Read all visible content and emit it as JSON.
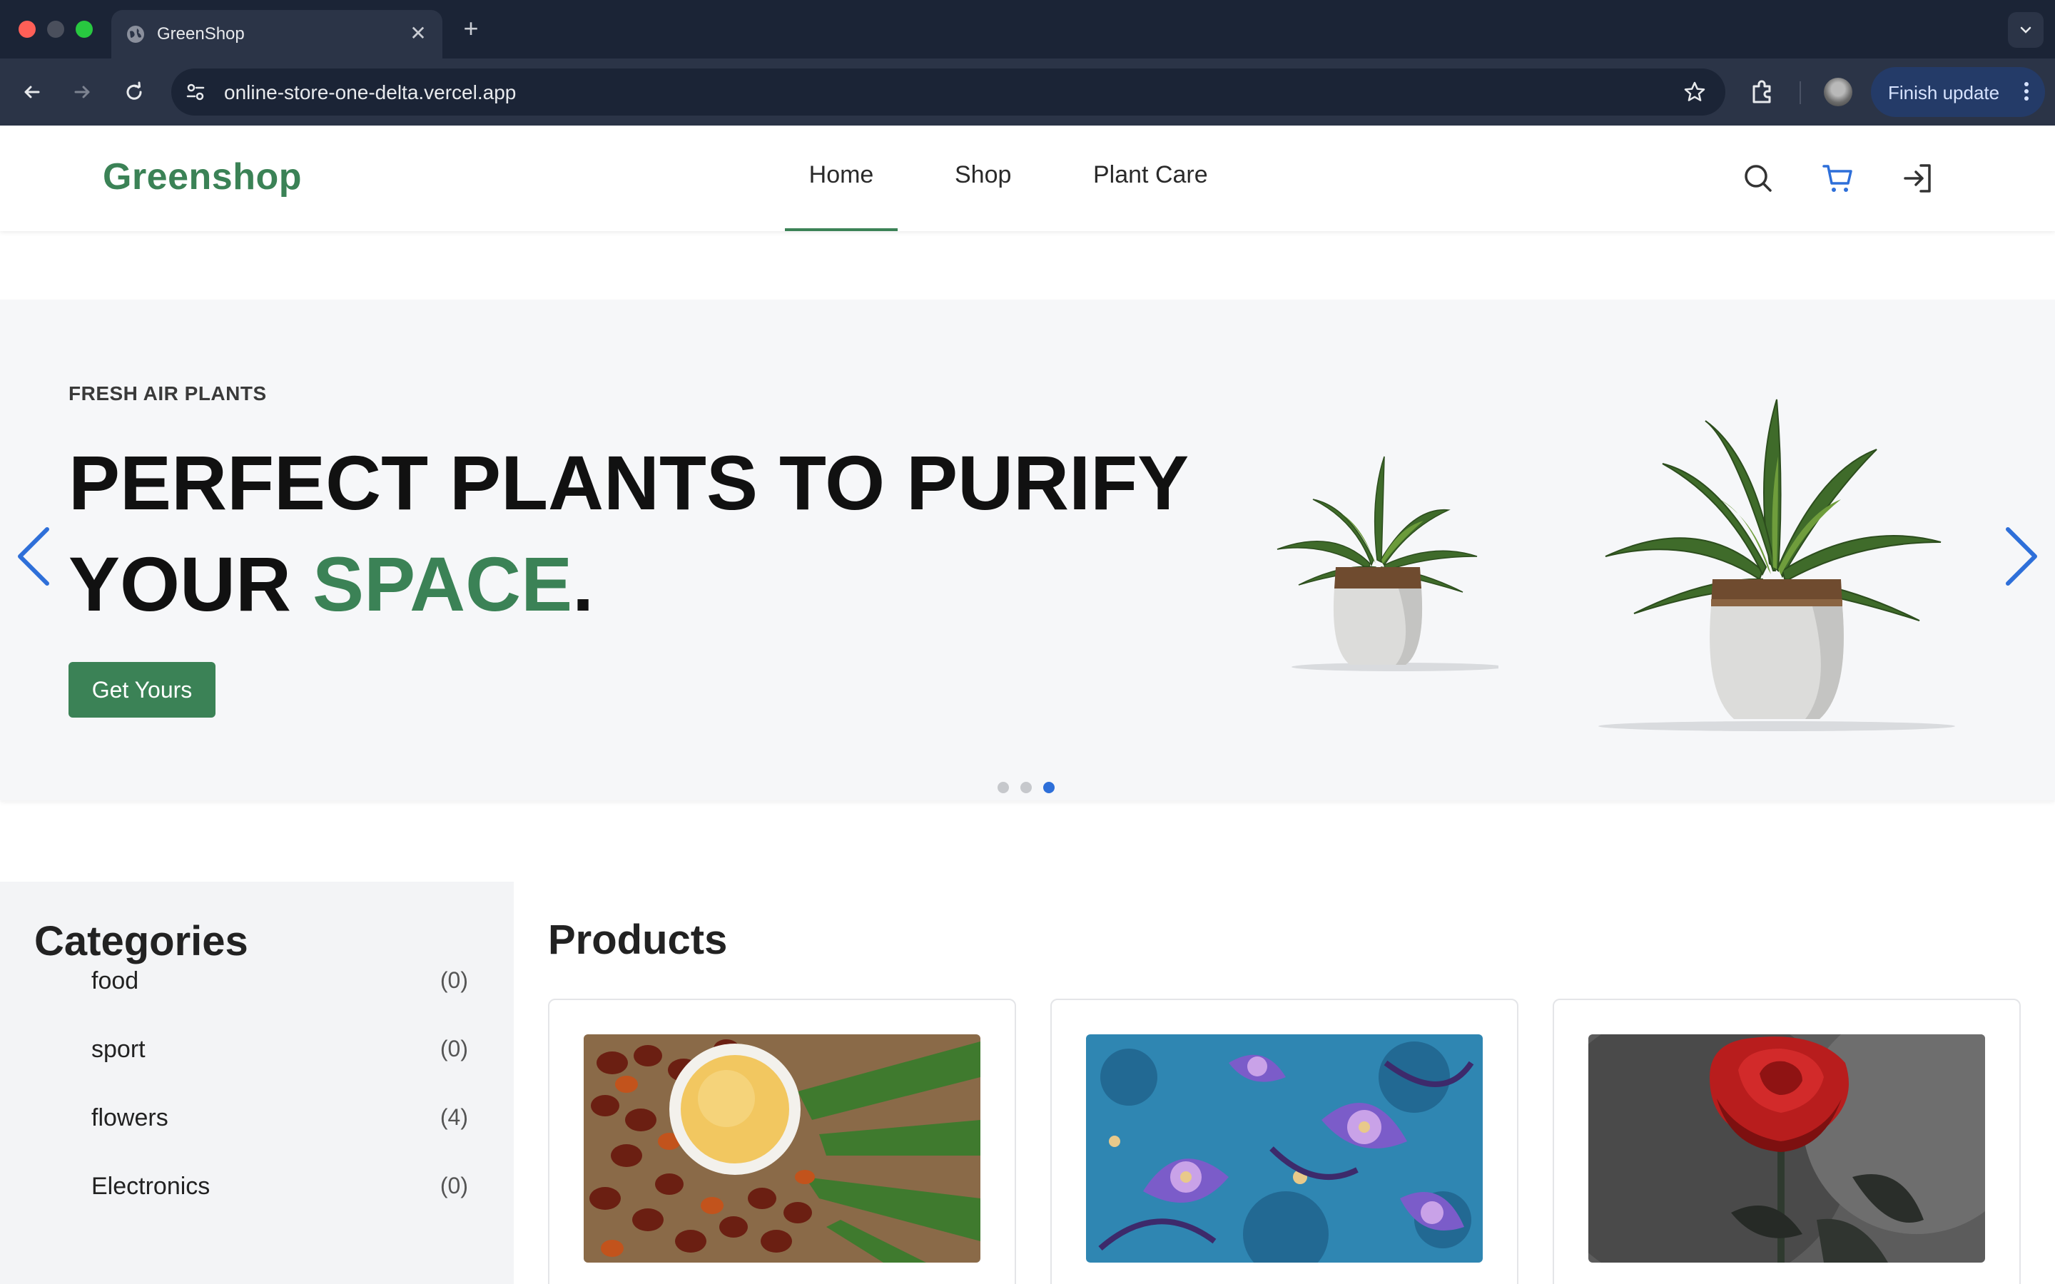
{
  "browser": {
    "tab_title": "GreenShop",
    "url": "online-store-one-delta.vercel.app",
    "finish_update_label": "Finish update"
  },
  "header": {
    "logo": "Greenshop",
    "nav": [
      {
        "label": "Home",
        "active": true
      },
      {
        "label": "Shop",
        "active": false
      },
      {
        "label": "Plant Care",
        "active": false
      }
    ],
    "icons": [
      "search-icon",
      "cart-icon",
      "login-icon"
    ]
  },
  "hero": {
    "eyebrow": "FRESH AIR PLANTS",
    "headline_line1": "PERFECT PLANTS TO PURIFY",
    "headline_line2_start": "YOUR ",
    "headline_accent": "SPACE",
    "headline_end": ".",
    "cta_label": "Get Yours",
    "slide_count": 3,
    "active_slide": 3
  },
  "categories": {
    "title": "Categories",
    "items": [
      {
        "name": "food",
        "count": "(0)"
      },
      {
        "name": "sport",
        "count": "(0)"
      },
      {
        "name": "flowers",
        "count": "(4)"
      },
      {
        "name": "Electronics",
        "count": "(0)"
      }
    ]
  },
  "products": {
    "title": "Products",
    "items": [
      {
        "image": "palm-oil-image"
      },
      {
        "image": "batik-fabric-image"
      },
      {
        "image": "red-rose-image"
      }
    ]
  },
  "colors": {
    "brand_green": "#3b8256",
    "accent_blue": "#2e6fd9",
    "chrome_dark": "#1b2436"
  }
}
